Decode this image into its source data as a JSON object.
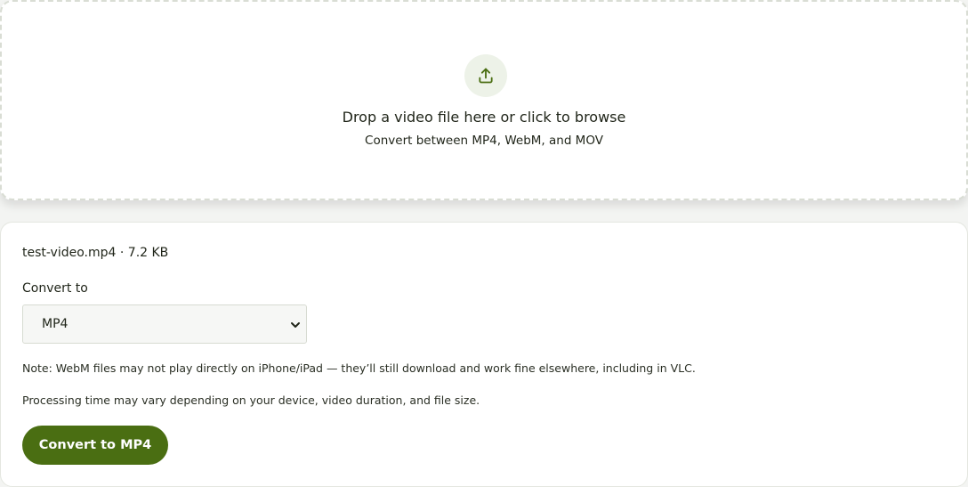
{
  "dropzone": {
    "icon": "upload-icon",
    "title": "Drop a video file here or click to browse",
    "subtitle": "Convert between MP4, WebM, and MOV"
  },
  "file": {
    "info": "test-video.mp4 · 7.2 KB"
  },
  "convert": {
    "label": "Convert to",
    "selected_format": "MP4",
    "button_label": "Convert to MP4"
  },
  "notes": {
    "webm_note": "Note: WebM files may not play directly on iPhone/iPad — they’ll still download and work fine elsewhere, including in VLC.",
    "processing_note": "Processing time may vary depending on your device, video duration, and file size."
  },
  "colors": {
    "accent": "#4a6e12",
    "icon_bg": "#edf2e8"
  }
}
